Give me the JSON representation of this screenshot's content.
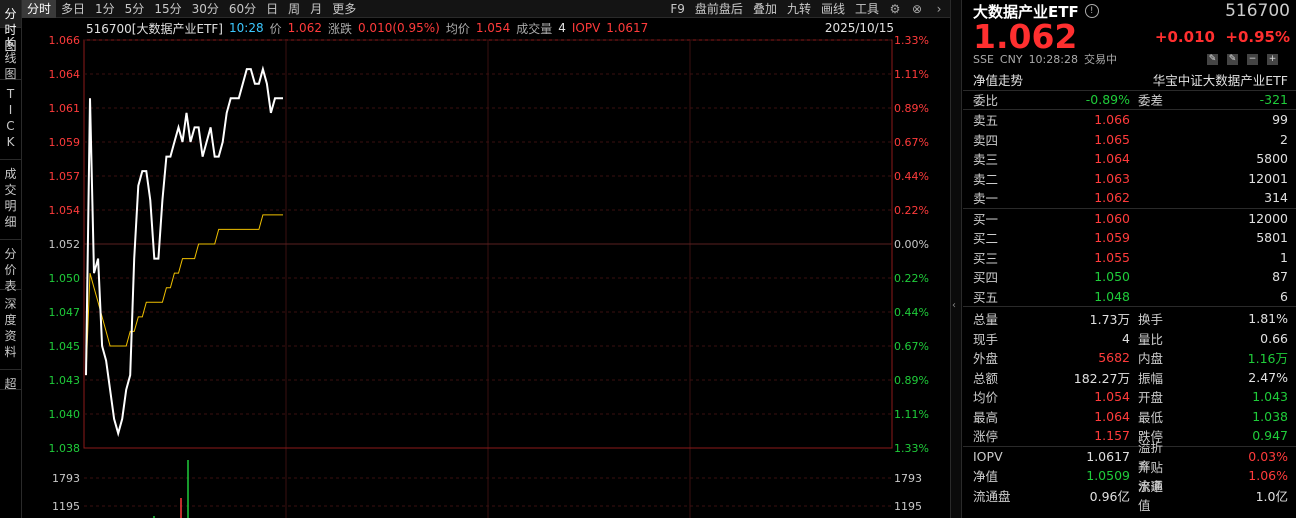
{
  "left_tabs": [
    "分时图",
    "K线图",
    "TICK",
    "成交明细",
    "分价表",
    "深度资料",
    "超"
  ],
  "period_tabs": [
    "分时",
    "多日",
    "1分",
    "5分",
    "15分",
    "30分",
    "60分",
    "日",
    "周",
    "月",
    "更多"
  ],
  "toolbar": [
    "F9",
    "盘前盘后",
    "叠加",
    "九转",
    "画线",
    "工具"
  ],
  "info": {
    "code_name": "516700[大数据产业ETF]",
    "time": "10:28",
    "price_label": "价",
    "price": "1.062",
    "change_label": "涨跌",
    "change": "0.010(0.95%)",
    "avg_label": "均价",
    "avg": "1.054",
    "vol_label": "成交量",
    "vol": "4",
    "iopv_label": "IOPV",
    "iopv": "1.0617",
    "date": "2025/10/15"
  },
  "chart_data": {
    "type": "line",
    "ylim": [
      1.038,
      1.066
    ],
    "prev_close": 1.052,
    "y_ticks_left": [
      "1.066",
      "1.064",
      "1.061",
      "1.059",
      "1.057",
      "1.054",
      "1.052",
      "1.050",
      "1.047",
      "1.045",
      "1.043",
      "1.040",
      "1.038"
    ],
    "y_ticks_right": [
      "1.33%",
      "1.11%",
      "0.89%",
      "0.67%",
      "0.44%",
      "0.22%",
      "0.00%",
      "0.22%",
      "0.44%",
      "0.67%",
      "0.89%",
      "1.11%",
      "1.33%"
    ],
    "vol_ticks": [
      "1793",
      "1195"
    ],
    "series": [
      {
        "values": [
          1.043,
          1.062,
          1.05,
          1.051,
          1.045,
          1.044,
          1.042,
          1.04,
          1.039,
          1.04,
          1.042,
          1.043,
          1.051,
          1.056,
          1.057,
          1.057,
          1.055,
          1.051,
          1.051,
          1.055,
          1.058,
          1.058,
          1.059,
          1.06,
          1.059,
          1.061,
          1.059,
          1.06,
          1.06,
          1.058,
          1.059,
          1.06,
          1.058,
          1.058,
          1.059,
          1.061,
          1.062,
          1.062,
          1.062,
          1.063,
          1.064,
          1.064,
          1.063,
          1.063,
          1.064,
          1.063,
          1.061,
          1.062,
          1.062,
          1.062
        ]
      },
      {
        "values": [
          1.043,
          1.05,
          1.049,
          1.048,
          1.047,
          1.046,
          1.045,
          1.045,
          1.045,
          1.045,
          1.045,
          1.046,
          1.046,
          1.047,
          1.047,
          1.048,
          1.048,
          1.048,
          1.048,
          1.048,
          1.049,
          1.049,
          1.05,
          1.05,
          1.051,
          1.051,
          1.051,
          1.051,
          1.052,
          1.052,
          1.052,
          1.052,
          1.052,
          1.053,
          1.053,
          1.053,
          1.053,
          1.053,
          1.053,
          1.053,
          1.053,
          1.053,
          1.053,
          1.053,
          1.054,
          1.054,
          1.054,
          1.054,
          1.054,
          1.054
        ]
      }
    ]
  },
  "quote": {
    "name": "大数据产业ETF",
    "code": "516700",
    "price": "1.062",
    "change": "+0.010",
    "change_pct": "+0.95%",
    "meta": [
      "SSE",
      "CNY",
      "10:28:28",
      "交易中"
    ],
    "nav_title": "净值走势",
    "nav_name": "华宝中证大数据产业ETF",
    "weibi_label": "委比",
    "weibi": "-0.89%",
    "weicha_label": "委差",
    "weicha": "-321",
    "asks": [
      {
        "label": "卖五",
        "price": "1.066",
        "vol": "99"
      },
      {
        "label": "卖四",
        "price": "1.065",
        "vol": "2"
      },
      {
        "label": "卖三",
        "price": "1.064",
        "vol": "5800"
      },
      {
        "label": "卖二",
        "price": "1.063",
        "vol": "12001"
      },
      {
        "label": "卖一",
        "price": "1.062",
        "vol": "314"
      }
    ],
    "bids": [
      {
        "label": "买一",
        "price": "1.060",
        "vol": "12000"
      },
      {
        "label": "买二",
        "price": "1.059",
        "vol": "5801"
      },
      {
        "label": "买三",
        "price": "1.055",
        "vol": "1"
      },
      {
        "label": "买四",
        "price": "1.050",
        "vol": "87"
      },
      {
        "label": "买五",
        "price": "1.048",
        "vol": "6"
      }
    ],
    "stats": [
      {
        "l1": "总量",
        "v1": "1.73万",
        "c1": "white",
        "l2": "换手",
        "v2": "1.81%",
        "c2": "white"
      },
      {
        "l1": "现手",
        "v1": "4",
        "c1": "white",
        "l2": "量比",
        "v2": "0.66",
        "c2": "white"
      },
      {
        "l1": "外盘",
        "v1": "5682",
        "c1": "red",
        "l2": "内盘",
        "v2": "1.16万",
        "c2": "green"
      },
      {
        "l1": "总额",
        "v1": "182.27万",
        "c1": "white",
        "l2": "振幅",
        "v2": "2.47%",
        "c2": "white"
      },
      {
        "l1": "均价",
        "v1": "1.054",
        "c1": "red",
        "l2": "开盘",
        "v2": "1.043",
        "c2": "green"
      },
      {
        "l1": "最高",
        "v1": "1.064",
        "c1": "red",
        "l2": "最低",
        "v2": "1.038",
        "c2": "green"
      },
      {
        "l1": "涨停",
        "v1": "1.157",
        "c1": "red",
        "l2": "跌停",
        "v2": "0.947",
        "c2": "green"
      }
    ],
    "stats2": [
      {
        "l1": "IOPV",
        "v1": "1.0617",
        "c1": "white",
        "l2": "溢折率",
        "v2": "0.03%",
        "c2": "red"
      },
      {
        "l1": "净值",
        "v1": "1.0509",
        "c1": "green",
        "l2": "升贴水率",
        "v2": "1.06%",
        "c2": "red"
      },
      {
        "l1": "流通盘",
        "v1": "0.96亿",
        "c1": "white",
        "l2": "流通值",
        "v2": "1.0亿",
        "c2": "white"
      }
    ]
  },
  "colors": {
    "up": "#ff3b3b",
    "down": "#1fcc3a",
    "avg": "#f0c000",
    "price": "#ffffff"
  }
}
